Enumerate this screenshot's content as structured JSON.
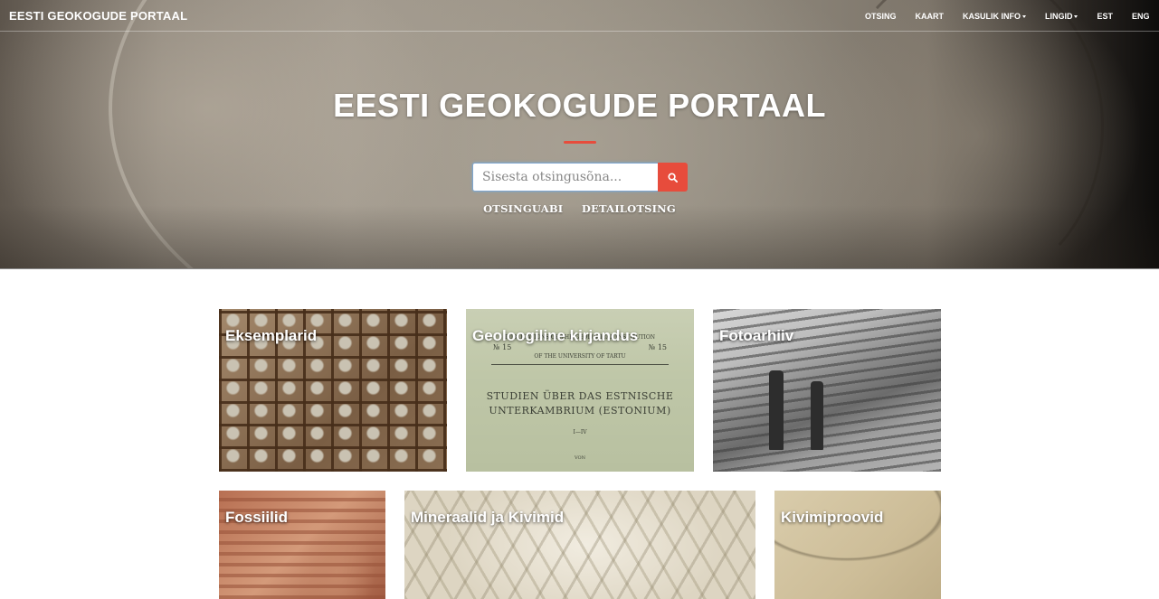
{
  "navbar": {
    "brand": "EESTI GEOKOGUDE PORTAAL",
    "items": [
      {
        "label": "OTSING",
        "dropdown": false
      },
      {
        "label": "KAART",
        "dropdown": false
      },
      {
        "label": "KASULIK INFO",
        "dropdown": true
      },
      {
        "label": "LINGID",
        "dropdown": true
      },
      {
        "label": "EST",
        "dropdown": false
      },
      {
        "label": "ENG",
        "dropdown": false
      }
    ]
  },
  "hero": {
    "title": "EESTI GEOKOGUDE PORTAAL",
    "accent_color": "#e74c3c",
    "search": {
      "placeholder": "Sisesta otsingusõna...",
      "value": "",
      "button_icon": "search-icon"
    },
    "links": {
      "help": "OTSINGUABI",
      "detailed": "DETAILOTSING"
    }
  },
  "tiles": [
    {
      "label": "Eksemplarid"
    },
    {
      "label": "Geoloogiline kirjandus"
    },
    {
      "label": "Fotoarhiiv"
    },
    {
      "label": "Fossiilid"
    },
    {
      "label": "Mineraalid ja Kivimid"
    },
    {
      "label": "Kivimiproovid"
    }
  ],
  "document_image": {
    "line1": "PUBLICATIONS OF THE GEOLOGICAL INSTITUTION",
    "line2": "OF THE UNIVERSITY OF TARTU",
    "number_left": "№ 15",
    "number_right": "№ 15",
    "title_line1": "STUDIEN ÜBER DAS ESTNISCHE",
    "title_line2": "UNTERKAMBRIUM (ESTONIUM)",
    "part": "I—IV",
    "footer": "VON"
  }
}
